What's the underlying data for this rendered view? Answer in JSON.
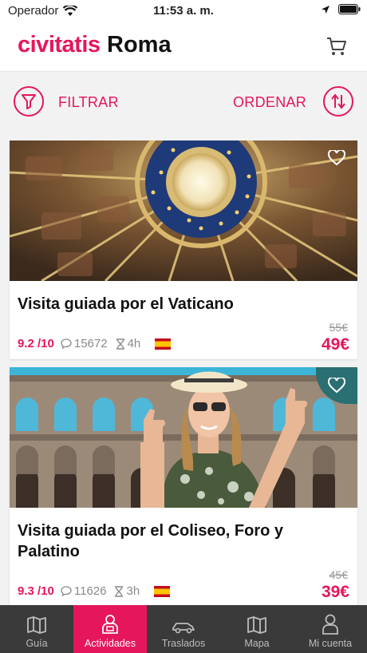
{
  "status": {
    "carrier": "Operador",
    "time": "11:53 a. m."
  },
  "header": {
    "logo": "civitatis",
    "city": "Roma"
  },
  "toolbar": {
    "filter_label": "FILTRAR",
    "sort_label": "ORDENAR"
  },
  "cards": [
    {
      "title": "Visita guiada por el Vaticano",
      "rating": "9.2 /10",
      "reviews": "15672",
      "duration": "4h",
      "old_price": "55€",
      "price": "49€"
    },
    {
      "title": "Visita guiada por el Coliseo, Foro y Palatino",
      "rating": "9.3 /10",
      "reviews": "11626",
      "duration": "3h",
      "old_price": "45€",
      "price": "39€"
    }
  ],
  "tabs": [
    {
      "label": "Guía",
      "icon": "map-book-icon"
    },
    {
      "label": "Actividades",
      "icon": "guide-person-icon"
    },
    {
      "label": "Traslados",
      "icon": "car-icon"
    },
    {
      "label": "Mapa",
      "icon": "map-icon"
    },
    {
      "label": "Mi cuenta",
      "icon": "user-icon"
    }
  ],
  "colors": {
    "accent": "#e5165c",
    "tabbar": "#3a3a3a",
    "badge": "#2a6f72"
  }
}
